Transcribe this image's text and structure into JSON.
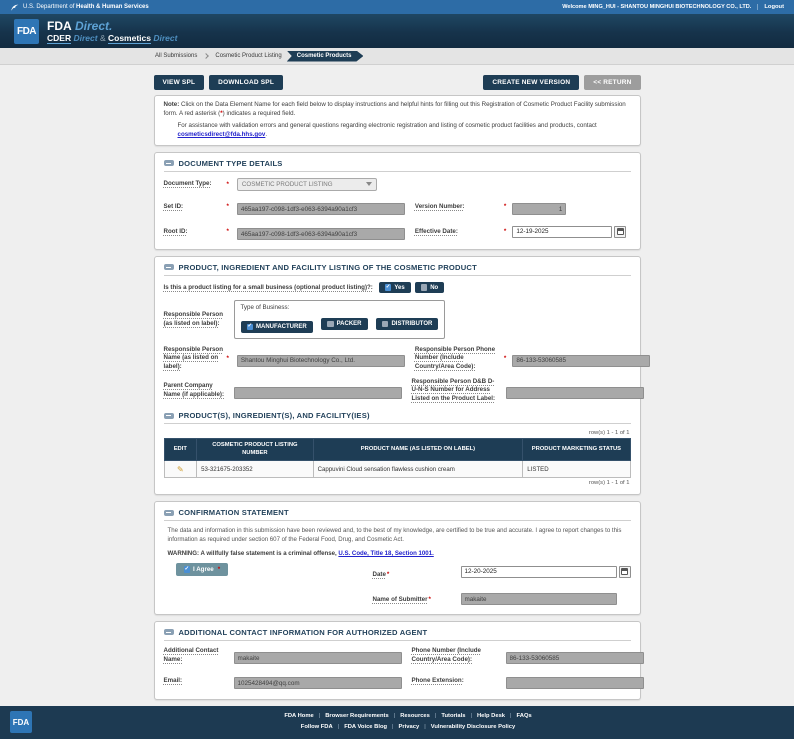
{
  "ui": {
    "asterisk": "*"
  },
  "colors": {
    "header_navy": "#16334b",
    "button_navy": "#1e3d55",
    "utility_blue": "#2d6ca6",
    "accent_blue": "#5da2d5",
    "link_blue": "#2222cc",
    "required_red": "#cc0000",
    "agree_teal": "#6e929e",
    "disabled_gray": "#a9a9a9"
  },
  "utility_bar": {
    "dept_prefix": "U.S. Department of",
    "dept_bold": "Health & Human Services",
    "welcome": "Welcome MING_HUI - SHANTOU MINGHUI BIOTECHNOLOGY CO., LTD.",
    "logout": "Logout"
  },
  "brand": {
    "logo_text": "FDA",
    "line1_main": "FDA",
    "line1_accent": "Direct.",
    "line2": [
      "CDER",
      "Direct",
      "&",
      "Cosmetics",
      "Direct"
    ]
  },
  "breadcrumb": {
    "items": [
      "All Submissions",
      "Cosmetic Product Listing",
      "Cosmetic Products"
    ]
  },
  "toolbar": {
    "view_spl": "VIEW SPL",
    "download_spl": "DOWNLOAD SPL",
    "create_new_version": "CREATE NEW VERSION",
    "return": "<< RETURN"
  },
  "note": {
    "label": "Note:",
    "body_1": " Click on the Data Element Name for each field below to display instructions and helpful hints for filling out this Registration of Cosmetic Product Facility submission form. A red asterisk (",
    "asterisk": "*",
    "body_2": ") indicates a required field.",
    "assist_1": "For assistance with validation errors and general questions regarding electronic registration and listing of cosmetic product facilities and products, contact ",
    "email_link": "cosmeticsdirect@fda.hhs.gov",
    "assist_2": "."
  },
  "document_type_details": {
    "title": "DOCUMENT TYPE DETAILS",
    "document_type_label": "Document Type:",
    "document_type_value": "COSMETIC PRODUCT LISTING",
    "set_id_label": "Set ID:",
    "set_id_value": "465aa197-c098-1df3-e063-6394a90a1cf3",
    "version_label": "Version Number:",
    "version_value": "1",
    "root_id_label": "Root ID:",
    "root_id_value": "465aa197-c098-1df3-e063-6394a90a1cf3",
    "effective_date_label": "Effective Date:",
    "effective_date_value": "12-19-2025"
  },
  "product_section": {
    "title": "PRODUCT, INGREDIENT AND FACILITY LISTING OF THE COSMETIC PRODUCT",
    "small_business_label": "Is this a product listing for a small business (optional product listing)?:",
    "yes_label": "Yes",
    "no_label": "No",
    "rp_label": "Responsible Person (as listed on label):",
    "type_of_business_label": "Type of Business:",
    "business_types": [
      "MANUFACTURER",
      "PACKER",
      "DISTRIBUTOR"
    ],
    "rp_name_label": "Responsible Person Name (as listed on label):",
    "rp_name_value": "Shantou Minghui Biotechnology Co., Ltd.",
    "rp_phone_label": "Responsible Person Phone Number (Include Country/Area Code):",
    "rp_phone_value": "86-133-53060585",
    "parent_company_label": "Parent Company Name (if applicable):",
    "parent_company_value": "",
    "duns_label": "Responsible Person D&B D-U-N-S Number for Address Listed on the Product Label:",
    "duns_value": ""
  },
  "products_table": {
    "title": "PRODUCT(S), INGREDIENT(S), AND FACILITY(IES)",
    "row_count_top": "row(s) 1 - 1 of 1",
    "row_count_bottom": "row(s) 1 - 1 of 1",
    "headers": [
      "EDIT",
      "COSMETIC PRODUCT LISTING NUMBER",
      "PRODUCT NAME (AS LISTED ON LABEL)",
      "PRODUCT MARKETING STATUS"
    ],
    "rows": [
      {
        "listing_number": "53-321675-203352",
        "product_name": "Cappuvini Cloud sensation flawless cushion cream",
        "status": "LISTED"
      }
    ]
  },
  "confirmation": {
    "title": "CONFIRMATION STATEMENT",
    "statement": "The data and information in this submission have been reviewed and, to the best of my knowledge, are certified to be true and accurate. I agree to report changes to this information as required under section 607 of the Federal Food, Drug, and Cosmetic Act.",
    "warning_prefix": "WARNING: A willfully false statement is a criminal offense, ",
    "warning_link": "U.S. Code, Title 18, Section 1001.",
    "i_agree_label": "I Agree",
    "date_label": "Date",
    "date_value": "12-20-2025",
    "submitter_label": "Name of Submitter",
    "submitter_value": "makaite"
  },
  "additional_contact": {
    "title": "ADDITIONAL CONTACT INFORMATION FOR AUTHORIZED AGENT",
    "name_label": "Additional Contact Name:",
    "name_value": "makaite",
    "phone_label": "Phone Number (Include Country/Area Code):",
    "phone_value": "86-133-53060585",
    "email_label": "Email:",
    "email_value": "1025428494@qq.com",
    "ext_label": "Phone Extension:",
    "ext_value": ""
  },
  "footer": {
    "links_row1": [
      "FDA Home",
      "Browser Requirements",
      "Resources",
      "Tutorials",
      "Help Desk",
      "FAQs"
    ],
    "links_row2": [
      "Follow FDA",
      "FDA Voice Blog",
      "Privacy",
      "Vulnerability Disclosure Policy"
    ],
    "logo_text": "FDA"
  }
}
